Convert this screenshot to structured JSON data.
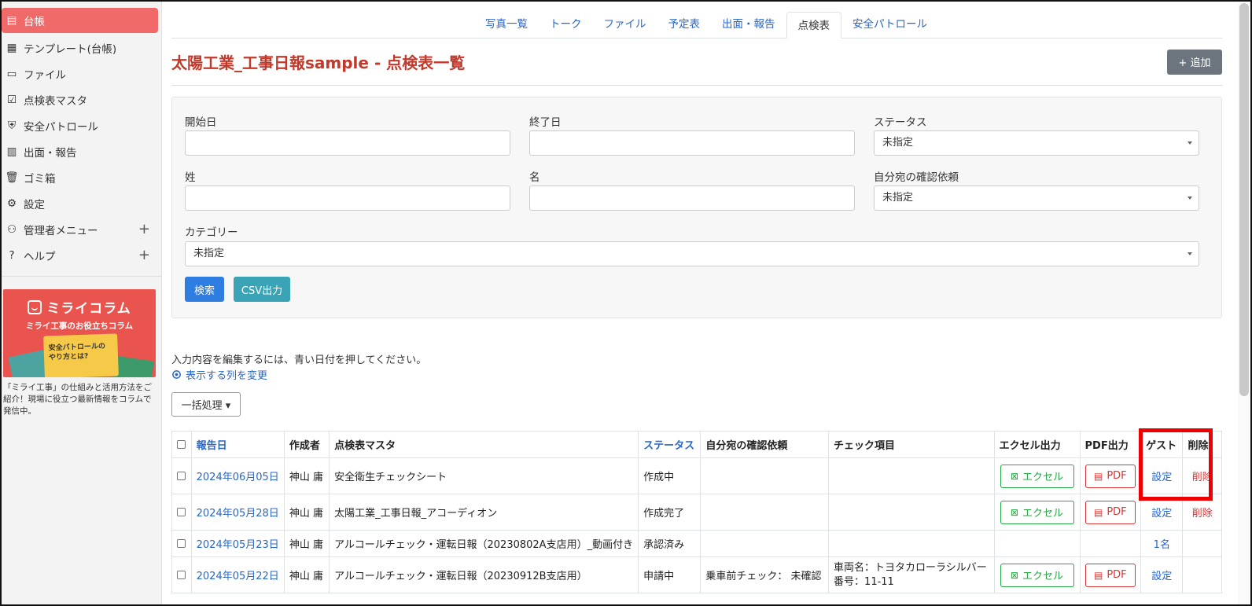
{
  "sidebar": {
    "items": [
      {
        "label": "台帳",
        "icon": "ledger-icon",
        "active": true
      },
      {
        "label": "テンプレート(台帳)",
        "icon": "template-icon"
      },
      {
        "label": "ファイル",
        "icon": "file-icon"
      },
      {
        "label": "点検表マスタ",
        "icon": "checklist-master-icon"
      },
      {
        "label": "安全パトロール",
        "icon": "patrol-icon"
      },
      {
        "label": "出面・報告",
        "icon": "report-icon"
      },
      {
        "label": "ゴミ箱",
        "icon": "trash-icon"
      },
      {
        "label": "設定",
        "icon": "gear-icon"
      },
      {
        "label": "管理者メニュー",
        "icon": "admin-icon",
        "plus": "+"
      },
      {
        "label": "ヘルプ",
        "icon": "help-icon",
        "plus": "+"
      }
    ],
    "banner": {
      "title": "ミライコラム",
      "subtitle": "ミライ工事のお役立ちコラム",
      "illus_text": "安全パトロールの\nやり方とは?"
    },
    "banner_desc": "「ミライ工事」の仕組みと活用方法をご紹介！現場に役立つ最新情報をコラムで発信中。"
  },
  "tabs": [
    "写真一覧",
    "トーク",
    "ファイル",
    "予定表",
    "出面・報告",
    "点検表",
    "安全パトロール"
  ],
  "active_tab": "点検表",
  "header": {
    "title": "太陽工業_工事日報sample - 点検表一覧",
    "add_label": "+ 追加"
  },
  "filters": {
    "start_date_label": "開始日",
    "end_date_label": "終了日",
    "status_label": "ステータス",
    "status_value": "未指定",
    "last_name_label": "姓",
    "first_name_label": "名",
    "request_label": "自分宛の確認依頼",
    "request_value": "未指定",
    "category_label": "カテゴリー",
    "category_value": "未指定",
    "search_label": "検索",
    "csv_label": "CSV出力"
  },
  "hint": "入力内容を編集するには、青い日付を押してください。",
  "columns_link": "表示する列を変更",
  "bulk_label": "一括処理 ▾",
  "table": {
    "headers": [
      "報告日",
      "作成者",
      "点検表マスタ",
      "ステータス",
      "自分宛の確認依頼",
      "チェック項目",
      "エクセル出力",
      "PDF出力",
      "ゲスト",
      "削除"
    ],
    "rows": [
      {
        "date": "2024年06月05日",
        "author": "神山 庸",
        "master": "安全衛生チェックシート",
        "status": "作成中",
        "request": "",
        "check": "",
        "excel": "エクセル",
        "pdf": "PDF",
        "guest": "設定",
        "delete": "削除"
      },
      {
        "date": "2024年05月28日",
        "author": "神山 庸",
        "master": "太陽工業_工事日報_アコーディオン",
        "status": "作成完了",
        "request": "",
        "check": "",
        "excel": "エクセル",
        "pdf": "PDF",
        "guest": "設定",
        "delete": "削除"
      },
      {
        "date": "2024年05月23日",
        "author": "神山 庸",
        "master": "アルコールチェック・運転日報（20230802A支店用）_動画付き",
        "status": "承認済み",
        "request": "",
        "check": "",
        "excel": "",
        "pdf": "",
        "guest": "1名",
        "delete": ""
      },
      {
        "date": "2024年05月22日",
        "author": "神山 庸",
        "master": "アルコールチェック・運転日報（20230912B支店用）",
        "status": "申請中",
        "request": "乗車前チェック： 未確認",
        "check1": "車両名：トヨタカローラシルバー",
        "check2": "番号：11-11",
        "excel": "エクセル",
        "pdf": "PDF",
        "guest": "設定",
        "delete": ""
      }
    ]
  },
  "colors": {
    "accent": "#f06a6a",
    "title": "#c0392b",
    "link": "#2a66c4",
    "highlight": "#e00000"
  }
}
